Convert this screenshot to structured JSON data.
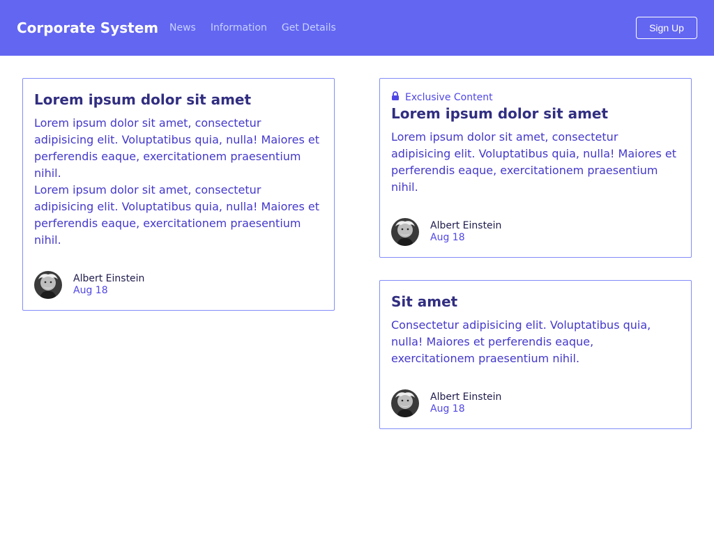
{
  "nav": {
    "brand": "Corporate System",
    "links": [
      "News",
      "Information",
      "Get Details"
    ],
    "signup_label": "Sign Up"
  },
  "cards": [
    {
      "title": "Lorem ipsum dolor sit amet",
      "paragraphs": [
        "Lorem ipsum dolor sit amet, consectetur adipisicing elit. Voluptatibus quia, nulla! Maiores et perferendis eaque, exercitationem praesentium nihil.",
        "Lorem ipsum dolor sit amet, consectetur adipisicing elit. Voluptatibus quia, nulla! Maiores et perferendis eaque, exercitationem praesentium nihil."
      ],
      "author": "Albert Einstein",
      "date": "Aug 18"
    },
    {
      "badge": "Exclusive Content",
      "badge_icon": "lock-icon",
      "title": "Lorem ipsum dolor sit amet",
      "paragraphs": [
        "Lorem ipsum dolor sit amet, consectetur adipisicing elit. Voluptatibus quia, nulla! Maiores et perferendis eaque, exercitationem praesentium nihil."
      ],
      "author": "Albert Einstein",
      "date": "Aug 18"
    },
    {
      "title": "Sit amet",
      "paragraphs": [
        "Consectetur adipisicing elit. Voluptatibus quia, nulla! Maiores et perferendis eaque, exercitationem praesentium nihil."
      ],
      "author": "Albert Einstein",
      "date": "Aug 18"
    }
  ],
  "colors": {
    "navbar_bg": "#6366f1",
    "card_border": "#818cf8",
    "title": "#312e81",
    "body_text": "#4338ca",
    "accent": "#4f46e5"
  }
}
